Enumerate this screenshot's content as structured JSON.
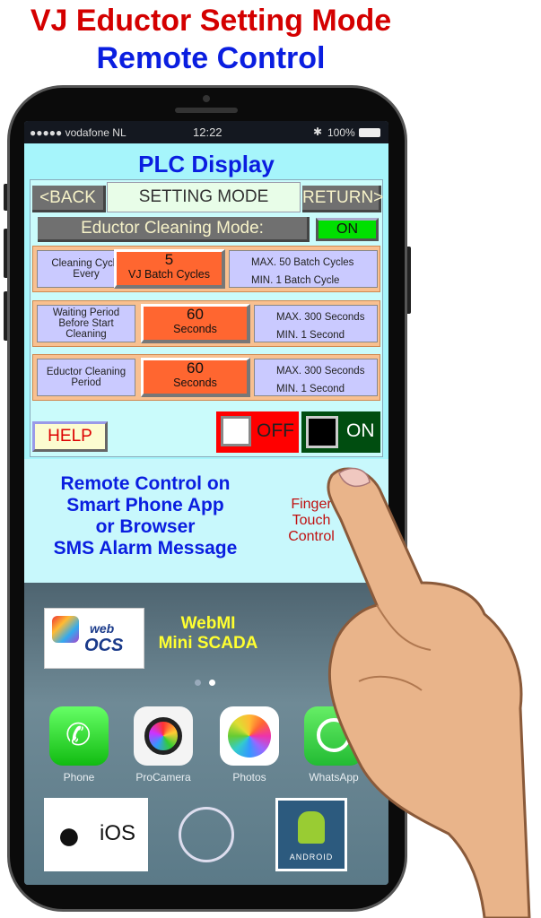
{
  "header": {
    "title": "VJ Eductor Setting Mode",
    "subtitle": "Remote Control"
  },
  "status_bar": {
    "carrier": "●●●●● vodafone NL",
    "time": "12:22",
    "battery": "100%"
  },
  "plc": {
    "title": "PLC Display",
    "back_label": "<BACK",
    "mode_label": "SETTING MODE",
    "return_label": "RETURN>",
    "eductor_mode_label": "Eductor Cleaning Mode:",
    "eductor_mode_state": "ON",
    "rows": [
      {
        "label": "Cleaning Cycle Every",
        "value": "5",
        "unit": "VJ Batch Cycles",
        "max": "MAX.  50 Batch Cycles",
        "min": "MIN.  1 Batch Cycle"
      },
      {
        "label": "Waiting Period Before Start Cleaning",
        "value": "60",
        "unit": "Seconds",
        "max": "MAX.  300 Seconds",
        "min": "MIN.  1 Second"
      },
      {
        "label": "Eductor Cleaning Period",
        "value": "60",
        "unit": "Seconds",
        "max": "MAX.  300 Seconds",
        "min": "MIN.  1 Second"
      }
    ],
    "help_label": "HELP",
    "off_label": "OFF",
    "on_label": "ON"
  },
  "remote": {
    "text": [
      "Remote Control on",
      "Smart Phone App",
      "or Browser",
      "SMS Alarm Message"
    ],
    "finger": [
      "Finger",
      "Touch",
      "Control"
    ]
  },
  "webmi": {
    "logo_top": "web",
    "logo_bottom": "OCS",
    "line1": "WebMI",
    "line2": "Mini SCADA"
  },
  "apps": [
    {
      "label": "Phone",
      "icon": "phone-icon"
    },
    {
      "label": "ProCamera",
      "icon": "camera-icon"
    },
    {
      "label": "Photos",
      "icon": "photos-icon"
    },
    {
      "label": "WhatsApp",
      "icon": "whatsapp-icon"
    }
  ],
  "dock": {
    "ios_label": "iOS",
    "android_label": "ANDROID"
  },
  "colors": {
    "title_red": "#d40000",
    "title_blue": "#0a1ee0",
    "value_orange": "#ff6630",
    "on_green": "#00e000",
    "off_red": "#ff0000",
    "on_dark": "#004d10"
  }
}
